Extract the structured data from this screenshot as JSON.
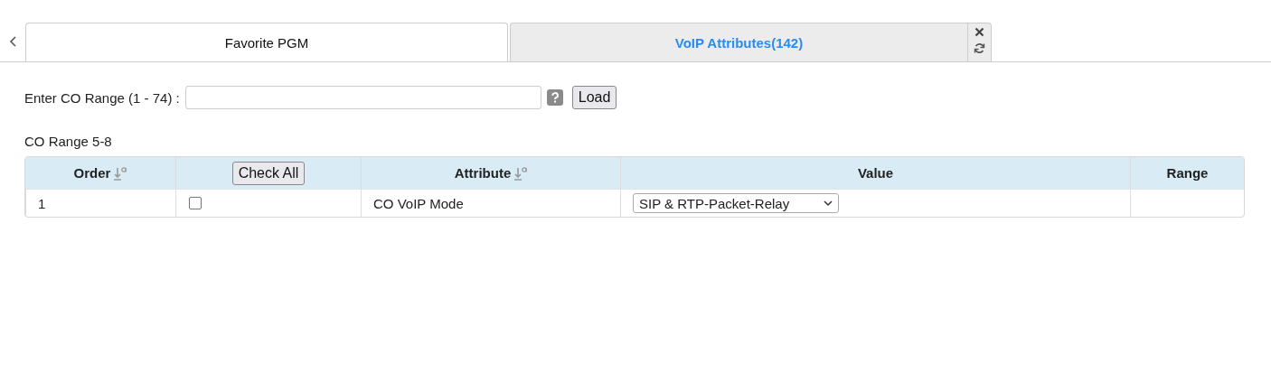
{
  "tabs": [
    {
      "label": "Favorite PGM",
      "selected": false
    },
    {
      "label": "VoIP Attributes(142)",
      "selected": true
    }
  ],
  "range_field": {
    "label": "Enter CO Range (1 - 74) :"
  },
  "load_button": "Load",
  "section_title": "CO Range 5-8",
  "table": {
    "columns": [
      {
        "kind": "sortable",
        "label": "Order"
      },
      {
        "kind": "button",
        "label": "Check All"
      },
      {
        "kind": "sortable",
        "label": "Attribute"
      },
      {
        "kind": "plain",
        "label": "Value"
      },
      {
        "kind": "plain",
        "label": "Range"
      }
    ],
    "rows": [
      {
        "order": "1",
        "checked": false,
        "attribute": "CO VoIP Mode",
        "value": "SIP & RTP-Packet-Relay"
      }
    ]
  }
}
